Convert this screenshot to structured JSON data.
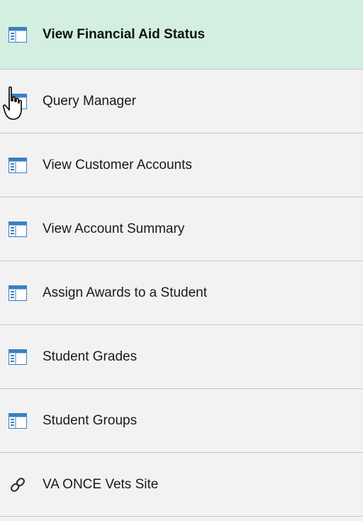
{
  "menu": {
    "items": [
      {
        "label": "View Financial Aid Status",
        "icon": "component-page-icon",
        "active": true
      },
      {
        "label": "Query Manager",
        "icon": "component-page-icon"
      },
      {
        "label": "View Customer Accounts",
        "icon": "component-page-icon"
      },
      {
        "label": "View Account Summary",
        "icon": "component-page-icon"
      },
      {
        "label": "Assign Awards to a Student",
        "icon": "component-page-icon"
      },
      {
        "label": "Student Grades",
        "icon": "component-page-icon"
      },
      {
        "label": "Student Groups",
        "icon": "component-page-icon"
      },
      {
        "label": "VA ONCE  Vets Site",
        "icon": "link-icon"
      }
    ]
  },
  "colors": {
    "active_background": "#d2efdf",
    "item_background": "#f2f2f2",
    "divider": "#c8c8c8",
    "icon_blue": "#3a7fc1"
  }
}
